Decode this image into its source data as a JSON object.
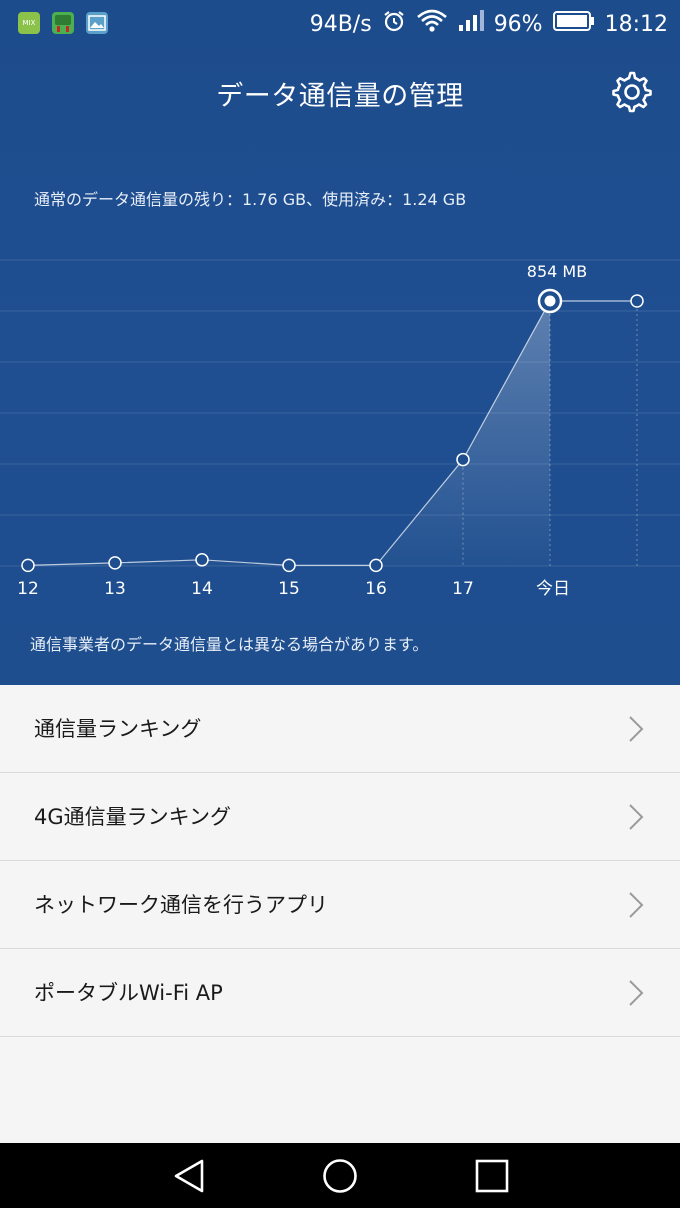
{
  "status_bar": {
    "notifications": [
      {
        "icon": "android-mix-icon",
        "text": "MIX",
        "color": "#8bc34a"
      },
      {
        "icon": "android-debug-icon",
        "text": "",
        "color": "#4caf50"
      },
      {
        "icon": "gallery-icon",
        "text": "",
        "color": "#5aa0c8"
      }
    ],
    "net_speed": "94B/s",
    "battery": "96%",
    "time": "18:12"
  },
  "header": {
    "title": "データ通信量の管理"
  },
  "summary_text": "通常のデータ通信量の残り：1.76 GB、使用済み：1.24 GB",
  "chart_data": {
    "type": "line",
    "categories": [
      "12",
      "13",
      "14",
      "15",
      "16",
      "17",
      "今日",
      ""
    ],
    "unit": "MB",
    "values": [
      2,
      10,
      20,
      2,
      2,
      343,
      854,
      854
    ],
    "highlight_label": "854 MB",
    "highlight_index": 6,
    "ylim": [
      0,
      1100
    ],
    "grid": true,
    "colors": {
      "line": "#ffffff",
      "fill": "#ffffff"
    }
  },
  "note_text": "通信事業者のデータ通信量とは異なる場合があります。",
  "menu": [
    {
      "label": "通信量ランキング"
    },
    {
      "label": "4G通信量ランキング"
    },
    {
      "label": "ネットワーク通信を行うアプリ"
    },
    {
      "label": "ポータブルWi-Fi AP"
    }
  ],
  "colors": {
    "header_bg": "#1e4e8e",
    "list_bg": "#f5f5f5",
    "navbar_bg": "#000000"
  }
}
